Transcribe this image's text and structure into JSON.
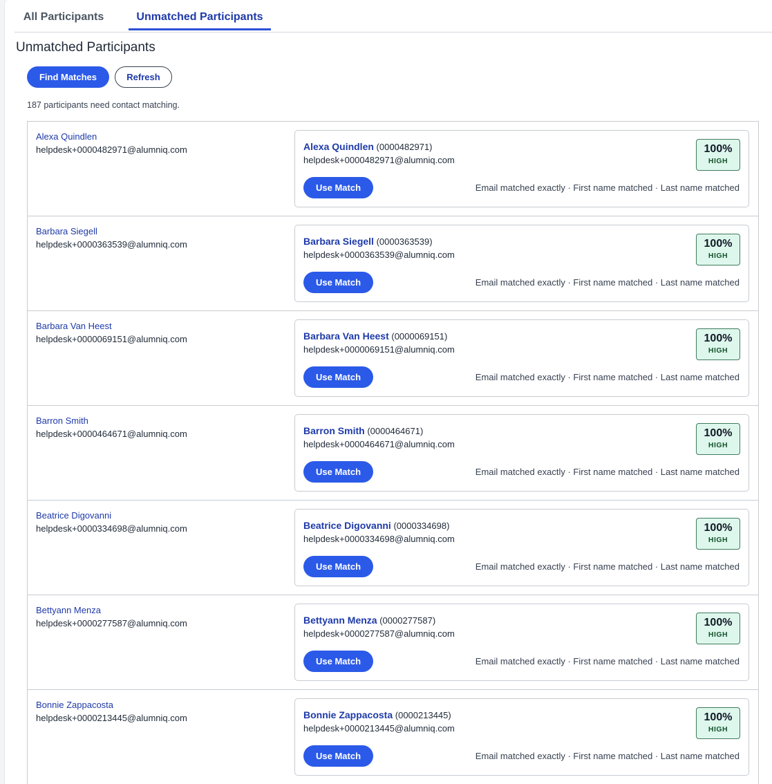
{
  "tabs": [
    {
      "label": "All Participants",
      "active": false
    },
    {
      "label": "Unmatched Participants",
      "active": true
    }
  ],
  "header": {
    "title": "Unmatched Participants",
    "find_matches_label": "Find Matches",
    "refresh_label": "Refresh",
    "summary": "187 participants need contact matching."
  },
  "colors": {
    "primary": "#2b5ae8",
    "link": "#1e3aa8",
    "badge_bg": "#def7ec",
    "badge_border": "#3f7a5c"
  },
  "participants": [
    {
      "name": "Alexa Quindlen",
      "email": "helpdesk+0000482971@alumniq.com",
      "match": {
        "name": "Alexa Quindlen",
        "id": "(0000482971)",
        "email": "helpdesk+0000482971@alumniq.com",
        "button": "Use Match",
        "reasons": "Email matched exactly · First name matched · Last name matched",
        "score": "100%",
        "level": "HIGH"
      }
    },
    {
      "name": "Barbara Siegell",
      "email": "helpdesk+0000363539@alumniq.com",
      "match": {
        "name": "Barbara Siegell",
        "id": "(0000363539)",
        "email": "helpdesk+0000363539@alumniq.com",
        "button": "Use Match",
        "reasons": "Email matched exactly · First name matched · Last name matched",
        "score": "100%",
        "level": "HIGH"
      }
    },
    {
      "name": "Barbara Van Heest",
      "email": "helpdesk+0000069151@alumniq.com",
      "match": {
        "name": "Barbara Van Heest",
        "id": "(0000069151)",
        "email": "helpdesk+0000069151@alumniq.com",
        "button": "Use Match",
        "reasons": "Email matched exactly · First name matched · Last name matched",
        "score": "100%",
        "level": "HIGH"
      }
    },
    {
      "name": "Barron Smith",
      "email": "helpdesk+0000464671@alumniq.com",
      "match": {
        "name": "Barron Smith",
        "id": "(0000464671)",
        "email": "helpdesk+0000464671@alumniq.com",
        "button": "Use Match",
        "reasons": "Email matched exactly · First name matched · Last name matched",
        "score": "100%",
        "level": "HIGH"
      }
    },
    {
      "name": "Beatrice Digovanni",
      "email": "helpdesk+0000334698@alumniq.com",
      "match": {
        "name": "Beatrice Digovanni",
        "id": "(0000334698)",
        "email": "helpdesk+0000334698@alumniq.com",
        "button": "Use Match",
        "reasons": "Email matched exactly · First name matched · Last name matched",
        "score": "100%",
        "level": "HIGH"
      }
    },
    {
      "name": "Bettyann Menza",
      "email": "helpdesk+0000277587@alumniq.com",
      "match": {
        "name": "Bettyann Menza",
        "id": "(0000277587)",
        "email": "helpdesk+0000277587@alumniq.com",
        "button": "Use Match",
        "reasons": "Email matched exactly · First name matched · Last name matched",
        "score": "100%",
        "level": "HIGH"
      }
    },
    {
      "name": "Bonnie Zappacosta",
      "email": "helpdesk+0000213445@alumniq.com",
      "match": {
        "name": "Bonnie Zappacosta",
        "id": "(0000213445)",
        "email": "helpdesk+0000213445@alumniq.com",
        "button": "Use Match",
        "reasons": "Email matched exactly · First name matched · Last name matched",
        "score": "100%",
        "level": "HIGH"
      }
    }
  ]
}
